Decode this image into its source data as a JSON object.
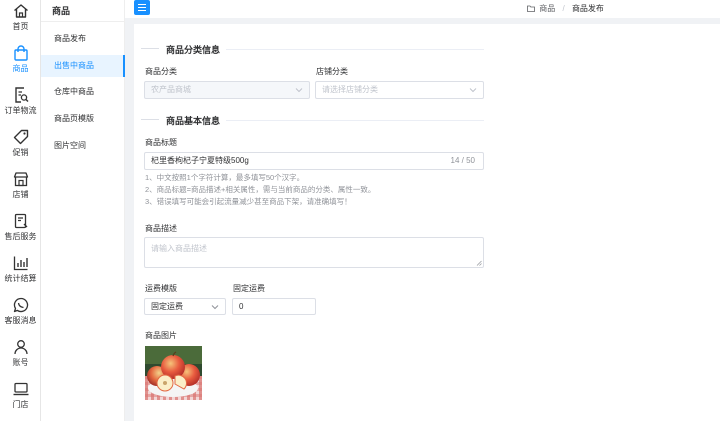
{
  "rail": {
    "items": [
      {
        "label": "首页"
      },
      {
        "label": "商品"
      },
      {
        "label": "订单物流"
      },
      {
        "label": "促销"
      },
      {
        "label": "店铺"
      },
      {
        "label": "售后服务"
      },
      {
        "label": "统计结算"
      },
      {
        "label": "客服消息"
      },
      {
        "label": "账号"
      },
      {
        "label": "门店"
      }
    ]
  },
  "submenu": {
    "title": "商品",
    "items": [
      {
        "label": "商品发布"
      },
      {
        "label": "出售中商品"
      },
      {
        "label": "仓库中商品"
      },
      {
        "label": "商品页模版"
      },
      {
        "label": "图片空间"
      }
    ]
  },
  "breadcrumb": {
    "parent": "商品",
    "separator": "/",
    "current": "商品发布"
  },
  "category_section": {
    "title": "商品分类信息",
    "goods_category_label": "商品分类",
    "goods_category_value": "农产品商城",
    "store_category_label": "店铺分类",
    "store_category_placeholder": "请选择店铺分类"
  },
  "basic_section": {
    "title": "商品基本信息",
    "goods_title_label": "商品标题",
    "goods_title_value": "杞里香枸杞子宁夏特级500g",
    "goods_title_count": "14 / 50",
    "hints": [
      "1、中文按照1个字符计算，最多填写50个汉字。",
      "2、商品标题=商品描述+相关属性，需与当前商品的分类、属性一致。",
      "3、错误填写可能会引起流量减少甚至商品下架，请准确填写！"
    ],
    "desc_label": "商品描述",
    "desc_placeholder": "请输入商品描述",
    "freight_template_label": "运费模版",
    "freight_template_value": "固定运费",
    "fixed_freight_label": "固定运费",
    "fixed_freight_value": "0",
    "images_label": "商品图片"
  },
  "colors": {
    "accent": "#1890ff",
    "active_bg": "#e8f4ff"
  }
}
